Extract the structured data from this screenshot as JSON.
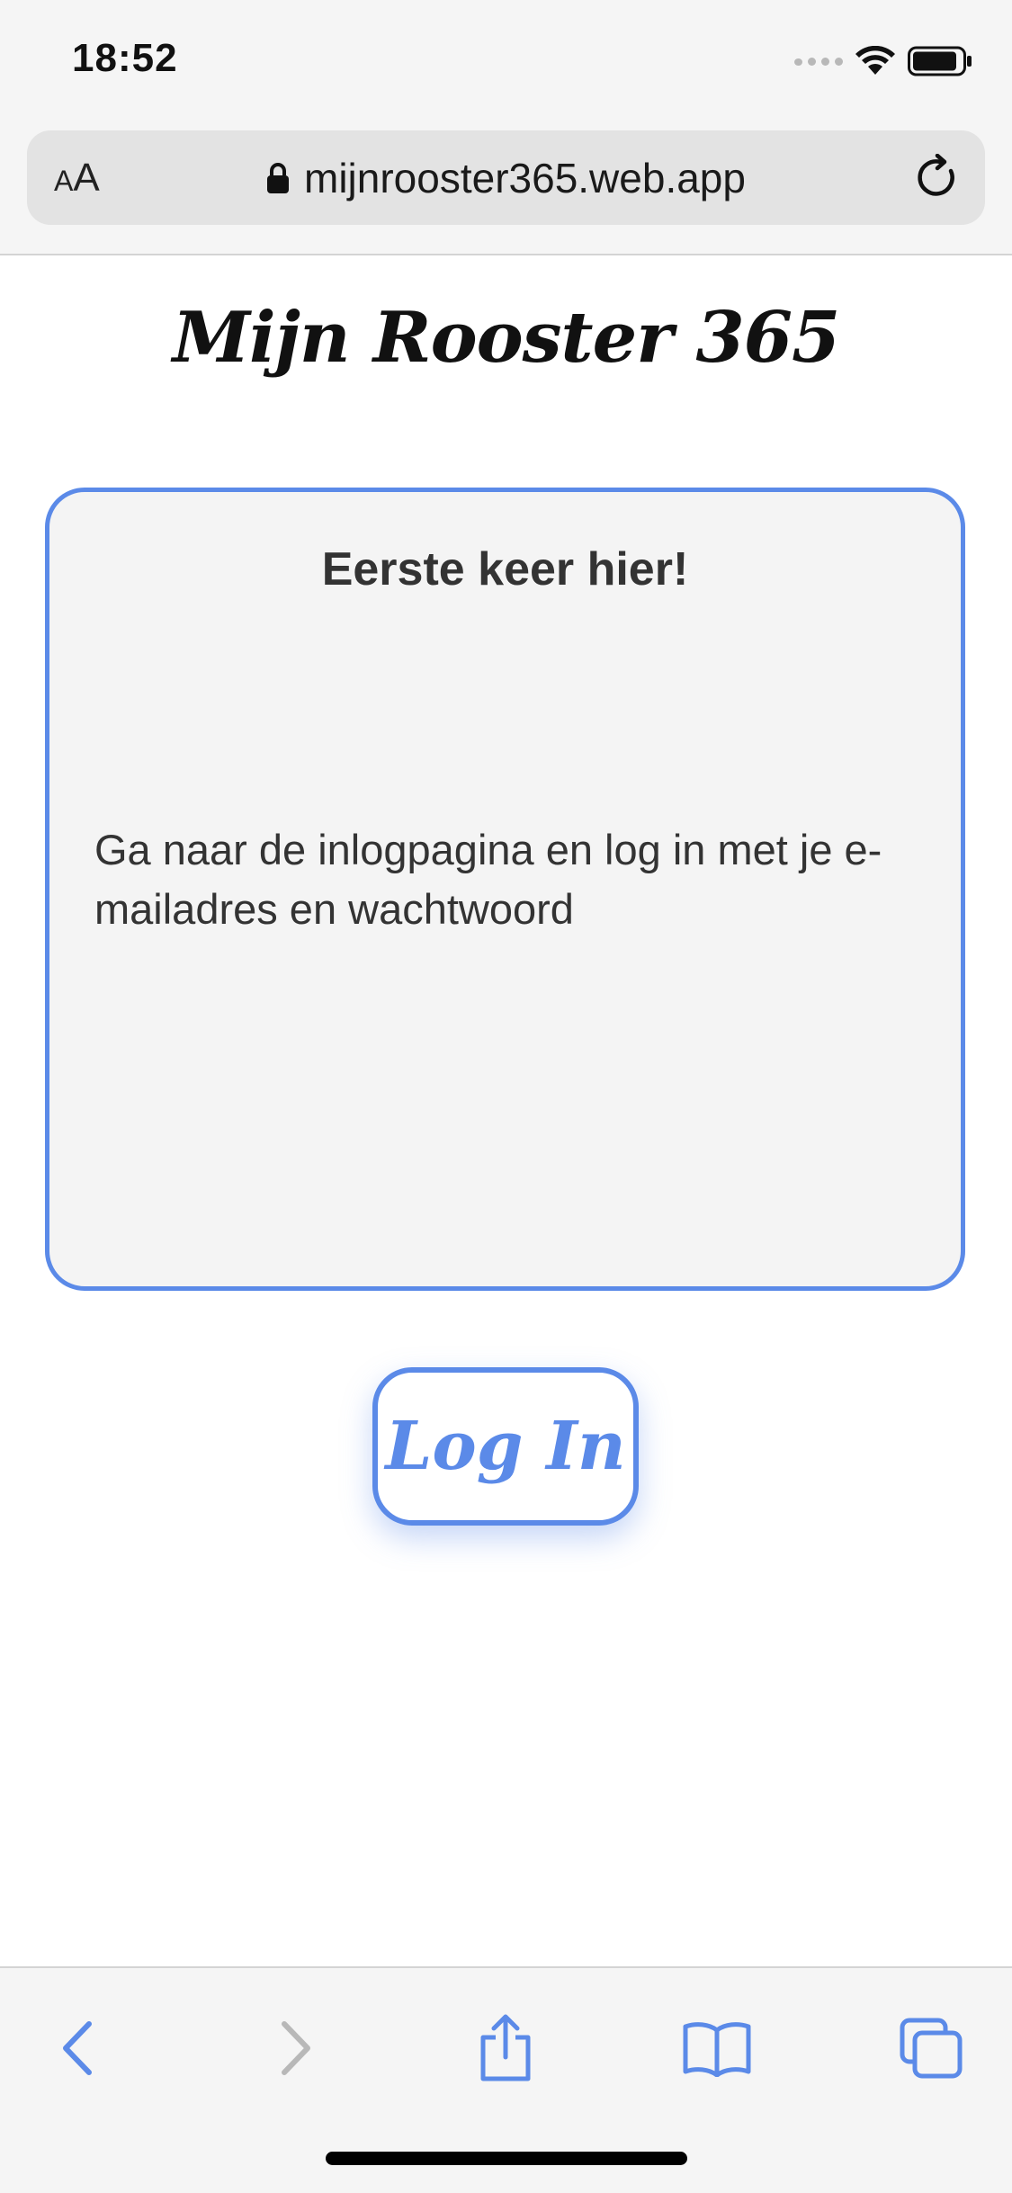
{
  "status_bar": {
    "time": "18:52"
  },
  "safari": {
    "aa_small": "A",
    "aa_large": "A",
    "url": "mijnrooster365.web.app",
    "toolbar": {
      "back": "chevron-left-icon",
      "forward": "chevron-right-icon",
      "share": "share-icon",
      "bookmarks": "book-icon",
      "tabs": "tabs-icon"
    }
  },
  "page": {
    "title": "Mijn Rooster 365",
    "card_title": "Eerste keer hier!",
    "card_text": "Ga naar de inlogpagina en log in met je e-mailadres en wachtwoord",
    "login_label": "Log In"
  },
  "colors": {
    "accent": "#5b8ae8",
    "card_bg": "#f4f4f4",
    "chrome_bg": "#f5f5f5",
    "disabled": "#b8b8b8"
  }
}
